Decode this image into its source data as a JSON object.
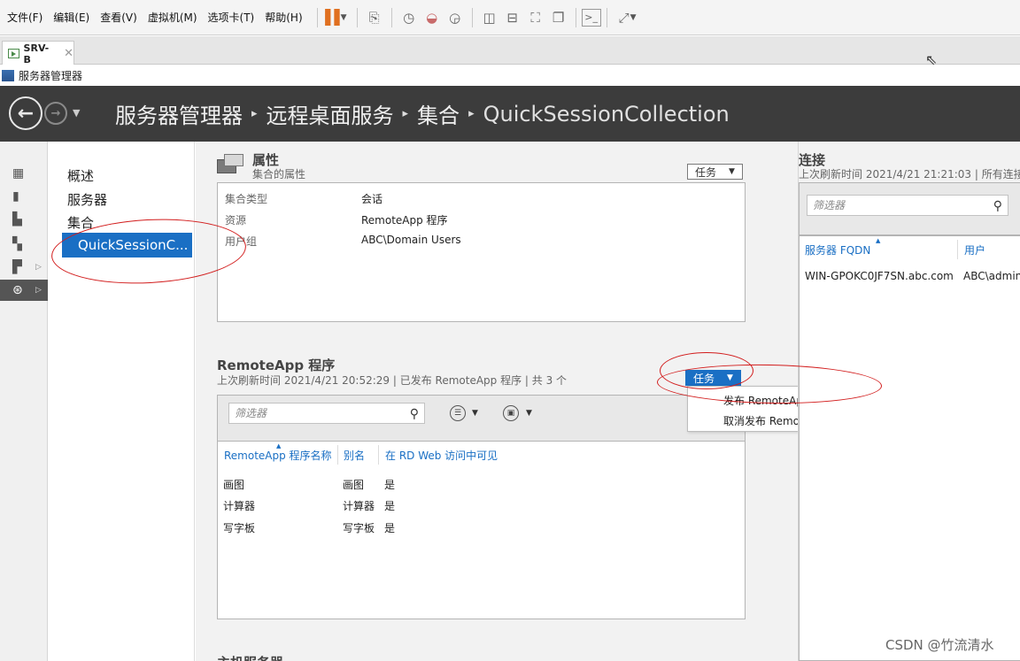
{
  "vmware": {
    "menu": [
      "文件(F)",
      "编辑(E)",
      "查看(V)",
      "虚拟机(M)",
      "选项卡(T)",
      "帮助(H)"
    ],
    "tab_label": "SRV-B",
    "tab_close": "✕"
  },
  "window": {
    "title": "服务器管理器"
  },
  "header": {
    "breadcrumb": [
      "服务器管理器",
      "远程桌面服务",
      "集合",
      "QuickSessionCollection"
    ],
    "sep": "▸"
  },
  "left_nav": {
    "items": [
      "概述",
      "服务器",
      "集合"
    ],
    "selected": "QuickSessionC..."
  },
  "properties": {
    "title": "属性",
    "subtitle": "集合的属性",
    "tasks_label": "任务",
    "rows": [
      {
        "key": "集合类型",
        "value": "会话"
      },
      {
        "key": "资源",
        "value": "RemoteApp 程序"
      },
      {
        "key": "用户组",
        "value": "ABC\\Domain Users"
      }
    ]
  },
  "remoteapp": {
    "title": "RemoteApp 程序",
    "subtitle": "上次刷新时间 2021/4/21 20:52:29 | 已发布 RemoteApp 程序 | 共 3 个",
    "tasks_label": "任务",
    "filter_placeholder": "筛选器",
    "columns": [
      "RemoteApp 程序名称",
      "别名",
      "在 RD Web 访问中可见"
    ],
    "rows": [
      [
        "画图",
        "画图",
        "是"
      ],
      [
        "计算器",
        "计算器",
        "是"
      ],
      [
        "写字板",
        "写字板",
        "是"
      ]
    ],
    "task_menu": [
      "发布 RemoteApp 程序(P)",
      "取消发布 RemoteApp 程序(U)"
    ]
  },
  "host_servers": {
    "title": "主机服务器"
  },
  "connections": {
    "title": "连接",
    "subtitle": "上次刷新时间 2021/4/21 21:21:03 | 所有连接",
    "filter_placeholder": "筛选器",
    "columns": [
      "服务器 FQDN",
      "用户"
    ],
    "rows": [
      [
        "WIN-GPOKC0JF7SN.abc.com",
        "ABC\\admin"
      ]
    ]
  },
  "watermark": "CSDN @竹流清水",
  "colors": {
    "accent": "#1a6fc4",
    "header_bg": "#3c3c3c",
    "annotation": "#d21c1c"
  }
}
